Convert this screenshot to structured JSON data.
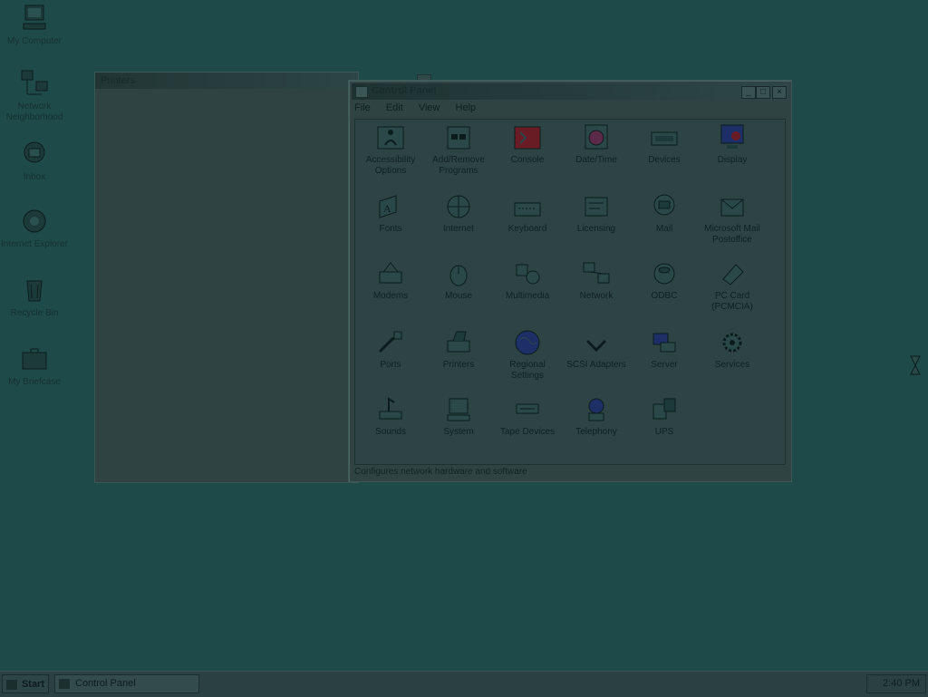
{
  "desktop": {
    "icons": [
      {
        "label": "My Computer",
        "icon": "computer-icon"
      },
      {
        "label": "Network Neighborhood",
        "icon": "network-neighborhood-icon"
      },
      {
        "label": "Inbox",
        "icon": "inbox-icon"
      },
      {
        "label": "Internet Explorer",
        "icon": "internet-explorer-icon"
      },
      {
        "label": "Recycle Bin",
        "icon": "recycle-bin-icon"
      },
      {
        "label": "My Briefcase",
        "icon": "briefcase-icon"
      }
    ]
  },
  "back_window": {
    "title": "Printers"
  },
  "control_panel": {
    "title": "Control Panel",
    "menu": [
      "File",
      "Edit",
      "View",
      "Help"
    ],
    "items": [
      {
        "label": "Accessibility Options",
        "icon": "accessibility-icon"
      },
      {
        "label": "Add/Remove Programs",
        "icon": "add-remove-programs-icon"
      },
      {
        "label": "Console",
        "icon": "console-icon"
      },
      {
        "label": "Date/Time",
        "icon": "date-time-icon"
      },
      {
        "label": "Devices",
        "icon": "devices-icon"
      },
      {
        "label": "Display",
        "icon": "display-icon"
      },
      {
        "label": "Fonts",
        "icon": "fonts-icon"
      },
      {
        "label": "Internet",
        "icon": "internet-icon"
      },
      {
        "label": "Keyboard",
        "icon": "keyboard-icon"
      },
      {
        "label": "Licensing",
        "icon": "licensing-icon"
      },
      {
        "label": "Mail",
        "icon": "mail-icon"
      },
      {
        "label": "Microsoft Mail Postoffice",
        "icon": "mail-postoffice-icon"
      },
      {
        "label": "Modems",
        "icon": "modems-icon"
      },
      {
        "label": "Mouse",
        "icon": "mouse-icon"
      },
      {
        "label": "Multimedia",
        "icon": "multimedia-icon"
      },
      {
        "label": "Network",
        "icon": "network-icon"
      },
      {
        "label": "ODBC",
        "icon": "odbc-icon"
      },
      {
        "label": "PC Card (PCMCIA)",
        "icon": "pc-card-icon"
      },
      {
        "label": "Ports",
        "icon": "ports-icon"
      },
      {
        "label": "Printers",
        "icon": "printers-icon"
      },
      {
        "label": "Regional Settings",
        "icon": "regional-settings-icon"
      },
      {
        "label": "SCSI Adapters",
        "icon": "scsi-adapters-icon"
      },
      {
        "label": "Server",
        "icon": "server-icon"
      },
      {
        "label": "Services",
        "icon": "services-icon"
      },
      {
        "label": "Sounds",
        "icon": "sounds-icon"
      },
      {
        "label": "System",
        "icon": "system-icon"
      },
      {
        "label": "Tape Devices",
        "icon": "tape-devices-icon"
      },
      {
        "label": "Telephony",
        "icon": "telephony-icon"
      },
      {
        "label": "UPS",
        "icon": "ups-icon"
      }
    ],
    "status": "Configures network hardware and software"
  },
  "taskbar": {
    "start_label": "Start",
    "task_label": "Control Panel",
    "clock": "2:40 PM"
  },
  "colors": {
    "desktop": "#1f4a4a",
    "window": "#2f4343"
  }
}
